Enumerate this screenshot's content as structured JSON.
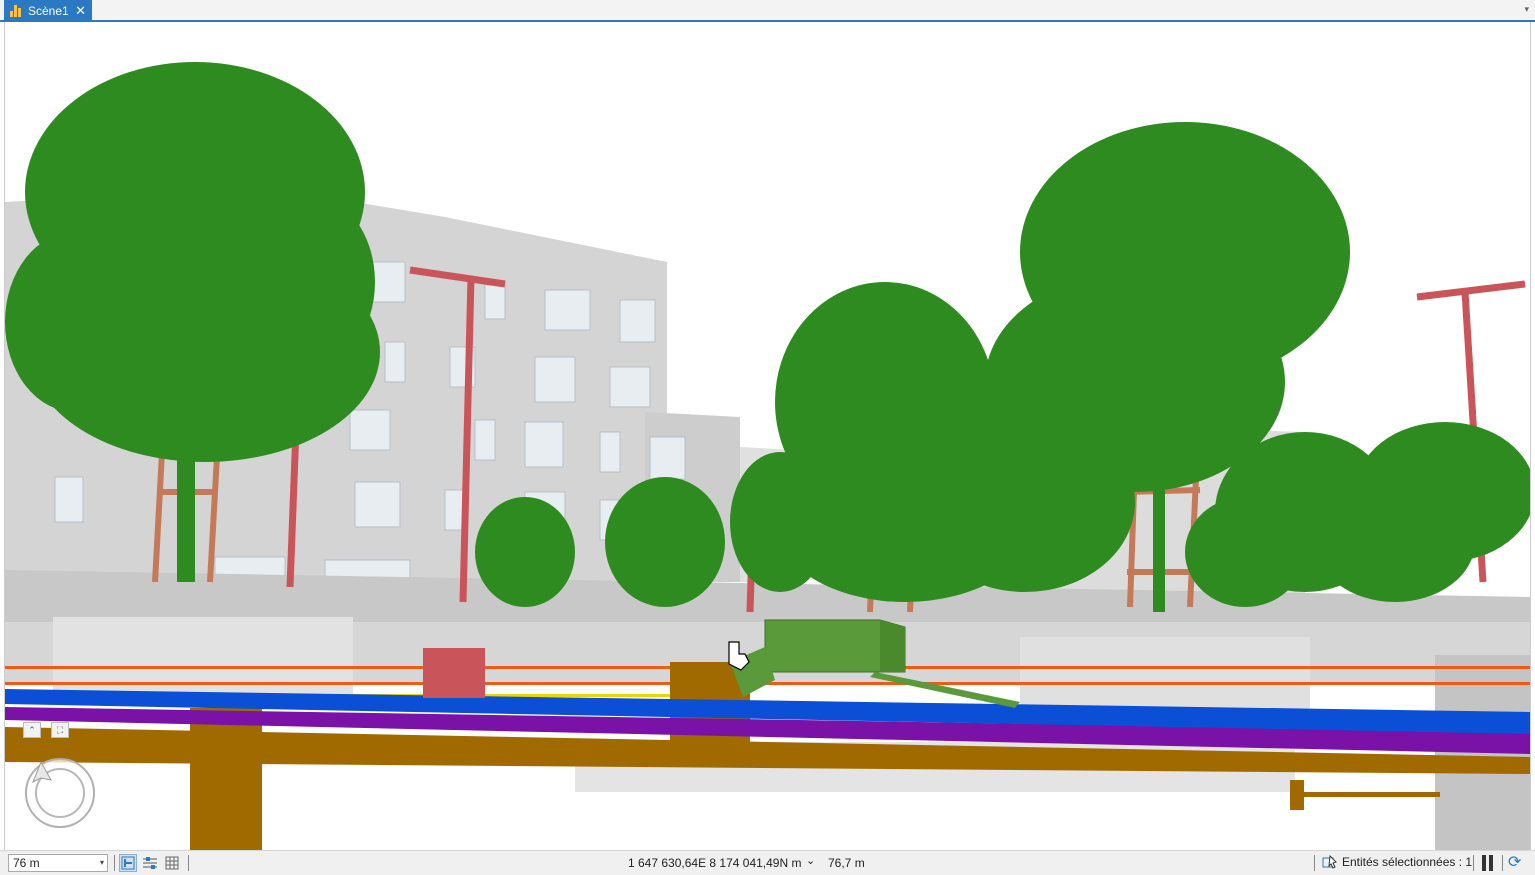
{
  "tab": {
    "title": "Scène1",
    "close_glyph": "✕",
    "menu_glyph": "▾"
  },
  "nav": {
    "up_glyph": "⌃",
    "full_glyph": "⛶"
  },
  "status": {
    "scale_value": "76 m",
    "scale_arrow": "▾",
    "coordinates": "1 647 630,64E 8 174 041,49N m",
    "coord_dropdown": "⌄",
    "elevation": "76,7 m",
    "selected_text": "Entités sélectionnées : 1",
    "refresh_glyph": "⟳"
  },
  "colors": {
    "accent": "#2b79c2",
    "foliage": "#2e8b1f",
    "building": "#d2d2d2",
    "lamp": "#c9555a",
    "pipe_blue": "#0a4fd6",
    "pipe_purple": "#7a12a8",
    "pipe_brown": "#a06a00",
    "pipe_orange": "#f05a12",
    "selected_box": "#5a9a3a"
  }
}
